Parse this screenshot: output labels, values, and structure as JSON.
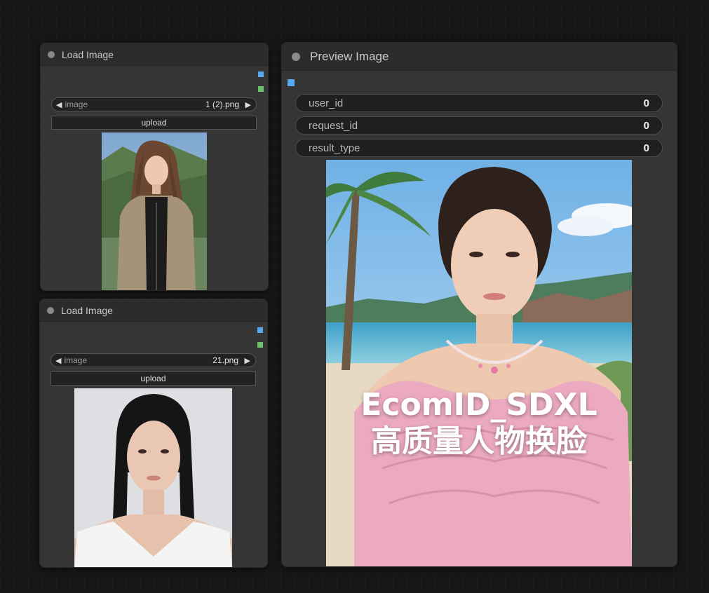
{
  "nodes": {
    "load1": {
      "title": "Load Image",
      "widget_label": "image",
      "filename": "1 (2).png",
      "upload_label": "upload"
    },
    "load2": {
      "title": "Load Image",
      "widget_label": "image",
      "filename": "21.png",
      "upload_label": "upload"
    },
    "preview": {
      "title": "Preview Image",
      "fields": [
        {
          "label": "user_id",
          "value": "0"
        },
        {
          "label": "request_id",
          "value": "0"
        },
        {
          "label": "result_type",
          "value": "0"
        }
      ],
      "overlay_line1": "EcomID_SDXL",
      "overlay_line2": "高质量人物换脸"
    }
  },
  "icons": {
    "left_arrow": "◀",
    "right_arrow": "▶"
  },
  "colors": {
    "canvas_bg": "#161616",
    "node_bg": "#353535",
    "slot_image": "#58a8ee",
    "slot_mask": "#6cc26c"
  }
}
